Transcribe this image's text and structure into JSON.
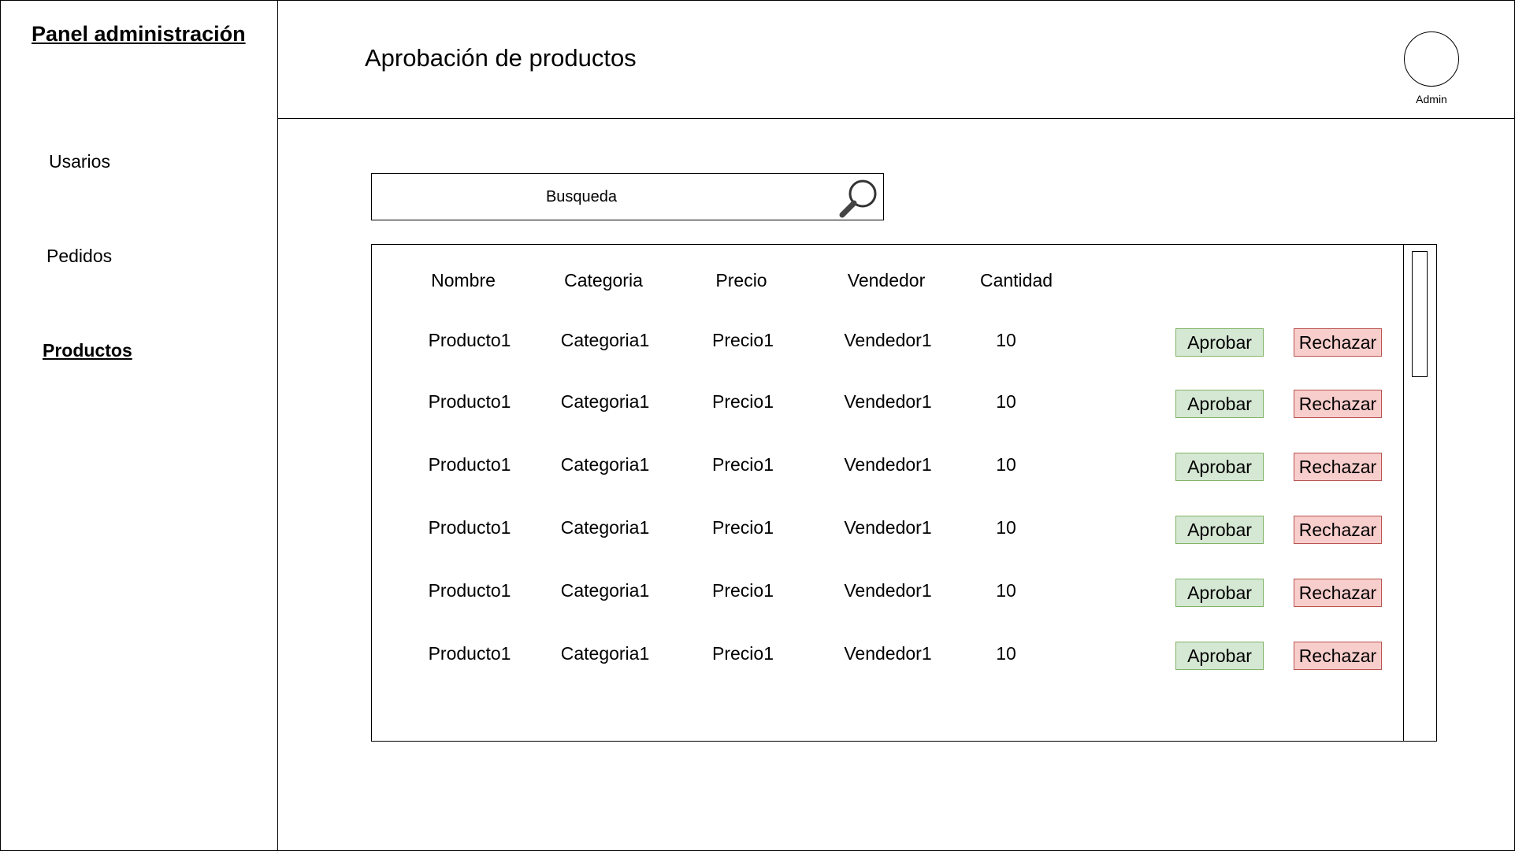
{
  "sidebar": {
    "title": "Panel administración",
    "items": [
      {
        "label": "Usarios",
        "active": false
      },
      {
        "label": "Pedidos",
        "active": false
      },
      {
        "label": "Productos",
        "active": true
      }
    ]
  },
  "header": {
    "title": "Aprobación de productos",
    "user_label": "Admin"
  },
  "search": {
    "placeholder": "Busqueda",
    "icon": "search-icon"
  },
  "table": {
    "columns": [
      "Nombre",
      "Categoria",
      "Precio",
      "Vendedor",
      "Cantidad"
    ],
    "rows": [
      {
        "nombre": "Producto1",
        "categoria": "Categoria1",
        "precio": "Precio1",
        "vendedor": "Vendedor1",
        "cantidad": "10"
      },
      {
        "nombre": "Producto1",
        "categoria": "Categoria1",
        "precio": "Precio1",
        "vendedor": "Vendedor1",
        "cantidad": "10"
      },
      {
        "nombre": "Producto1",
        "categoria": "Categoria1",
        "precio": "Precio1",
        "vendedor": "Vendedor1",
        "cantidad": "10"
      },
      {
        "nombre": "Producto1",
        "categoria": "Categoria1",
        "precio": "Precio1",
        "vendedor": "Vendedor1",
        "cantidad": "10"
      },
      {
        "nombre": "Producto1",
        "categoria": "Categoria1",
        "precio": "Precio1",
        "vendedor": "Vendedor1",
        "cantidad": "10"
      },
      {
        "nombre": "Producto1",
        "categoria": "Categoria1",
        "precio": "Precio1",
        "vendedor": "Vendedor1",
        "cantidad": "10"
      }
    ],
    "approve_label": "Aprobar",
    "reject_label": "Rechazar"
  },
  "colors": {
    "approve_fill": "#d5e8d4",
    "approve_border": "#82b366",
    "reject_fill": "#f8cecc",
    "reject_border": "#b85450"
  }
}
